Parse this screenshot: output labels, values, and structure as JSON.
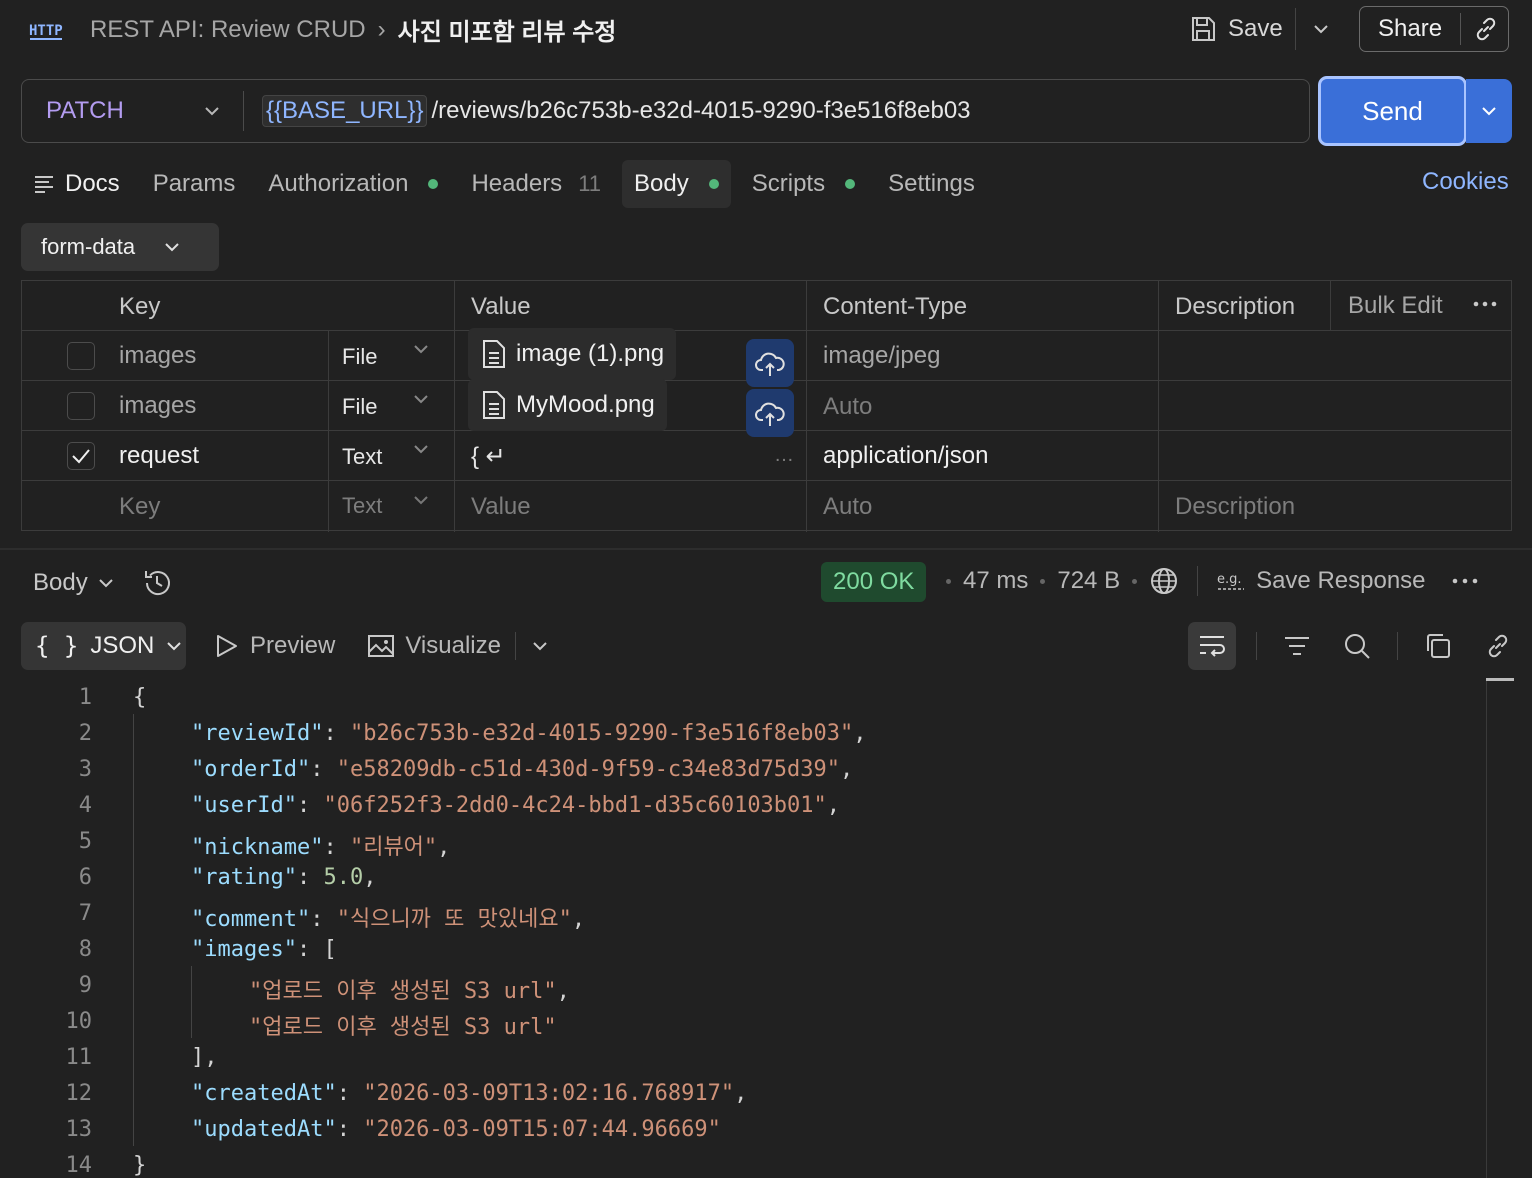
{
  "header": {
    "breadcrumb_parent": "REST API: Review CRUD",
    "breadcrumb_current": "사진 미포함 리뷰 수정",
    "save_label": "Save",
    "share_label": "Share"
  },
  "request": {
    "method": "PATCH",
    "url_variable": "{{BASE_URL}}",
    "url_path": "/reviews/b26c753b-e32d-4015-9290-f3e516f8eb03",
    "send_label": "Send"
  },
  "tabs": {
    "docs": "Docs",
    "params": "Params",
    "authorization": "Authorization",
    "headers": "Headers",
    "headers_count": "11",
    "body": "Body",
    "scripts": "Scripts",
    "settings": "Settings",
    "cookies": "Cookies"
  },
  "body_mode": "form-data",
  "table": {
    "headers": {
      "key": "Key",
      "value": "Value",
      "content_type": "Content-Type",
      "description": "Description",
      "bulk_edit": "Bulk Edit"
    },
    "rows": [
      {
        "checked": false,
        "key": "images",
        "type": "File",
        "value": "image (1).png",
        "content_type": "image/jpeg"
      },
      {
        "checked": false,
        "key": "images",
        "type": "File",
        "value": "MyMood.png",
        "content_type": "Auto"
      },
      {
        "checked": true,
        "key": "request",
        "type": "Text",
        "value": "{ ↵",
        "content_type": "application/json"
      }
    ],
    "placeholders": {
      "key": "Key",
      "type": "Text",
      "value": "Value",
      "content_type": "Auto",
      "description": "Description"
    }
  },
  "response": {
    "body_label": "Body",
    "status": "200 OK",
    "time": "47 ms",
    "size": "724 B",
    "save_response": "Save Response",
    "format": "JSON",
    "preview": "Preview",
    "visualize": "Visualize"
  },
  "code_lines": [
    "1",
    "2",
    "3",
    "4",
    "5",
    "6",
    "7",
    "8",
    "9",
    "10",
    "11",
    "12",
    "13",
    "14"
  ],
  "json": {
    "reviewId_key": "\"reviewId\"",
    "reviewId_val": "\"b26c753b-e32d-4015-9290-f3e516f8eb03\"",
    "orderId_key": "\"orderId\"",
    "orderId_val": "\"e58209db-c51d-430d-9f59-c34e83d75d39\"",
    "userId_key": "\"userId\"",
    "userId_val": "\"06f252f3-2dd0-4c24-bbd1-d35c60103b01\"",
    "nickname_key": "\"nickname\"",
    "nickname_val": "\"리뷰어\"",
    "rating_key": "\"rating\"",
    "rating_val": "5.0",
    "comment_key": "\"comment\"",
    "comment_val": "\"식으니까 또 맛있네요\"",
    "images_key": "\"images\"",
    "image_1": "\"업로드 이후 생성된 S3 url\"",
    "image_2": "\"업로드 이후 생성된 S3 url\"",
    "createdAt_key": "\"createdAt\"",
    "createdAt_val": "\"2026-03-09T13:02:16.768917\"",
    "updatedAt_key": "\"updatedAt\"",
    "updatedAt_val": "\"2026-03-09T15:07:44.96669\""
  },
  "colors": {
    "accent": "#3a6fd8",
    "method": "#b39cf0",
    "status_bg": "#1f4a2e",
    "status_fg": "#7fdba0",
    "dot": "#53b77a"
  }
}
